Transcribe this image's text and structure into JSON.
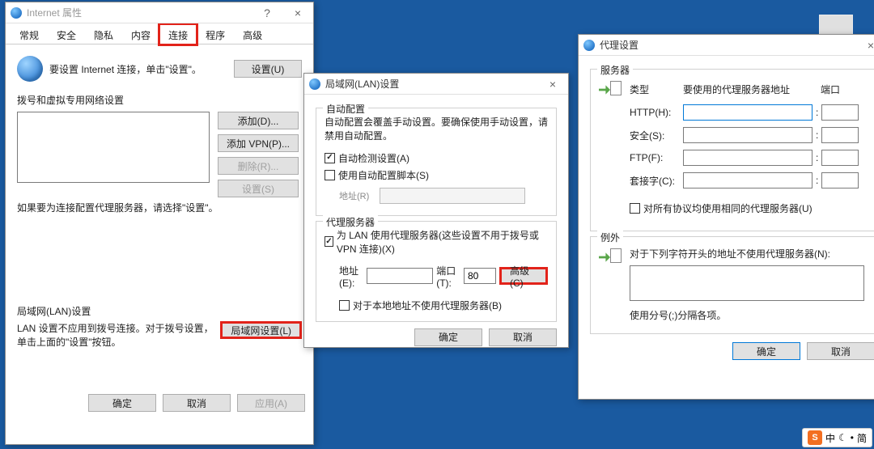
{
  "desktop": {
    "icon_label": ""
  },
  "ime": {
    "brand": "S",
    "lang": "中",
    "moon": "☾",
    "sep": "•",
    "mode": "简"
  },
  "win1": {
    "title": "Internet 属性",
    "help": "?",
    "close": "×",
    "tabs": [
      "常规",
      "安全",
      "隐私",
      "内容",
      "连接",
      "程序",
      "高级"
    ],
    "active_tab_index": 4,
    "conn_text": "要设置 Internet 连接，单击\"设置\"。",
    "btn_setup": "设置(U)",
    "dial_heading": "拨号和虚拟专用网络设置",
    "btn_add": "添加(D)...",
    "btn_add_vpn": "添加 VPN(P)...",
    "btn_remove": "删除(R)...",
    "btn_settings": "设置(S)",
    "proxy_note": "如果要为连接配置代理服务器，请选择\"设置\"。",
    "lan_heading": "局域网(LAN)设置",
    "lan_note": "LAN 设置不应用到拨号连接。对于拨号设置，单击上面的\"设置\"按钮。",
    "btn_lan": "局域网设置(L)",
    "btn_ok": "确定",
    "btn_cancel": "取消",
    "btn_apply": "应用(A)"
  },
  "win2": {
    "title": "局域网(LAN)设置",
    "close": "×",
    "auto_legend": "自动配置",
    "auto_text": "自动配置会覆盖手动设置。要确保使用手动设置，请禁用自动配置。",
    "chk_auto_detect": "自动检测设置(A)",
    "chk_auto_script": "使用自动配置脚本(S)",
    "addr_label": "地址(R)",
    "proxy_legend": "代理服务器",
    "chk_use_proxy": "为 LAN 使用代理服务器(这些设置不用于拨号或 VPN 连接)(X)",
    "addr2_label": "地址(E):",
    "port_label": "端口(T):",
    "port_value": "80",
    "btn_advanced": "高级(C)",
    "chk_bypass": "对于本地地址不使用代理服务器(B)",
    "btn_ok": "确定",
    "btn_cancel": "取消"
  },
  "win3": {
    "title": "代理设置",
    "close": "×",
    "srv_legend": "服务器",
    "col_type": "类型",
    "col_addr": "要使用的代理服务器地址",
    "col_port": "端口",
    "row_http": "HTTP(H):",
    "row_secure": "安全(S):",
    "row_ftp": "FTP(F):",
    "row_socks": "套接字(C):",
    "chk_same": "对所有协议均使用相同的代理服务器(U)",
    "exc_legend": "例外",
    "exc_text": "对于下列字符开头的地址不使用代理服务器(N):",
    "exc_hint": "使用分号(;)分隔各项。",
    "btn_ok": "确定",
    "btn_cancel": "取消"
  }
}
